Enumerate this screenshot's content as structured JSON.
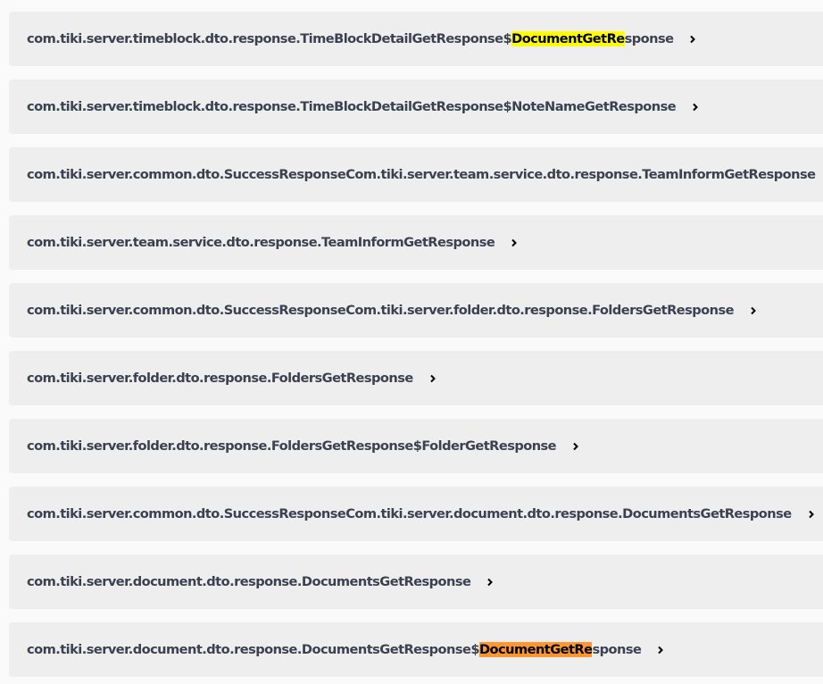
{
  "models": [
    {
      "pre": "com.tiki.server.timeblock.dto.response.TimeBlockDetailGetResponse$",
      "match": "DocumentGetRe",
      "post": "sponse",
      "highlight": "#ffff00"
    },
    {
      "pre": "com.tiki.server.timeblock.dto.response.TimeBlockDetailGetResponse$NoteNameGetResponse",
      "match": "",
      "post": ""
    },
    {
      "pre": "com.tiki.server.common.dto.SuccessResponseCom.tiki.server.team.service.dto.response.TeamInformGetResponse",
      "match": "",
      "post": ""
    },
    {
      "pre": "com.tiki.server.team.service.dto.response.TeamInformGetResponse",
      "match": "",
      "post": ""
    },
    {
      "pre": "com.tiki.server.common.dto.SuccessResponseCom.tiki.server.folder.dto.response.FoldersGetResponse",
      "match": "",
      "post": ""
    },
    {
      "pre": "com.tiki.server.folder.dto.response.FoldersGetResponse",
      "match": "",
      "post": ""
    },
    {
      "pre": "com.tiki.server.folder.dto.response.FoldersGetResponse$FolderGetResponse",
      "match": "",
      "post": ""
    },
    {
      "pre": "com.tiki.server.common.dto.SuccessResponseCom.tiki.server.document.dto.response.DocumentsGetResponse",
      "match": "",
      "post": ""
    },
    {
      "pre": "com.tiki.server.document.dto.response.DocumentsGetResponse",
      "match": "",
      "post": ""
    },
    {
      "pre": "com.tiki.server.document.dto.response.DocumentsGetResponse$",
      "match": "DocumentGetRe",
      "post": "sponse",
      "highlight": "#ff9632"
    }
  ],
  "icons": {
    "expand": "chevron-right-icon"
  },
  "colors": {
    "row_background": "#eeeeee",
    "text": "#3b4151",
    "find_highlight": "#ffff00",
    "find_highlight_active": "#ff9632"
  }
}
